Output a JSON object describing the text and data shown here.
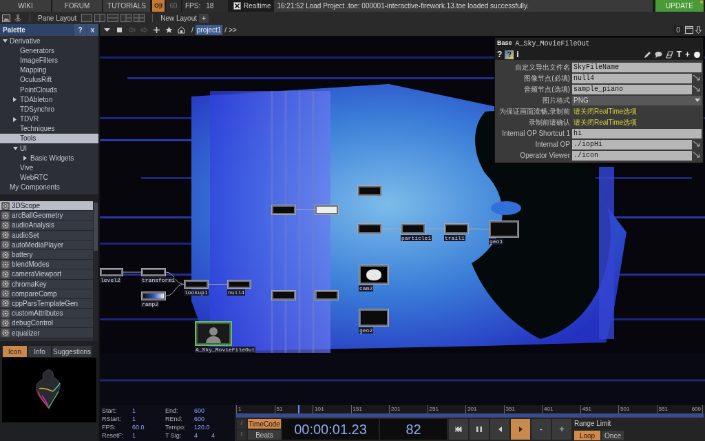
{
  "menu_bar": {
    "buttons": [
      {
        "label": "WIKI"
      },
      {
        "label": "FORUM"
      },
      {
        "label": "TUTORIALS"
      }
    ],
    "perform_toggle": {
      "label": "O|I",
      "on": true
    },
    "fps_cap": "60",
    "fps": {
      "label": "FPS:",
      "value": "18"
    },
    "realtime": {
      "label": "Realtime",
      "checked": true
    },
    "message": "16:21:52 Load Project .toe: 000001-interactive-firework.13.toe loaded successfully.",
    "update_button": {
      "label": "UPDATE",
      "notify": true
    }
  },
  "layout_bar": {
    "pane_layout": "Pane Layout",
    "layouts": [
      {
        "kind": "single"
      },
      {
        "kind": "columns"
      },
      {
        "kind": "rows"
      },
      {
        "kind": "triple"
      },
      {
        "kind": "quad"
      }
    ],
    "new_layout": "New Layout",
    "add_button": "+"
  },
  "palette": {
    "title": "Palette",
    "buttons": [
      "?",
      "x"
    ],
    "tree": [
      {
        "label": "Derivative",
        "kind": "folder",
        "expanded": true,
        "selected": false,
        "children": [
          {
            "label": "Generators",
            "kind": "leaf",
            "selected": false
          },
          {
            "label": "ImageFilters",
            "kind": "leaf",
            "selected": false
          },
          {
            "label": "Mapping",
            "kind": "leaf",
            "selected": false
          },
          {
            "label": "OculusRift",
            "kind": "leaf",
            "selected": false
          },
          {
            "label": "PointClouds",
            "kind": "leaf",
            "selected": false
          },
          {
            "label": "TDAbleton",
            "kind": "folder",
            "expanded": false,
            "selected": false
          },
          {
            "label": "TDSynchro",
            "kind": "leaf",
            "selected": false
          },
          {
            "label": "TDVR",
            "kind": "folder",
            "expanded": false,
            "selected": false
          },
          {
            "label": "Techniques",
            "kind": "leaf",
            "selected": false
          },
          {
            "label": "Tools",
            "kind": "leaf",
            "selected": true
          },
          {
            "label": "UI",
            "kind": "folder",
            "expanded": true,
            "selected": false,
            "children": [
              {
                "label": "Basic Widgets",
                "kind": "folder",
                "expanded": false,
                "selected": false
              }
            ]
          },
          {
            "label": "Vive",
            "kind": "leaf",
            "selected": false
          },
          {
            "label": "WebRTC",
            "kind": "leaf",
            "selected": false
          }
        ]
      },
      {
        "label": "My Components",
        "kind": "leaf",
        "selected": false
      }
    ],
    "components": [
      {
        "label": "3DScope",
        "selected": true
      },
      {
        "label": "arcBallGeometry",
        "selected": false
      },
      {
        "label": "audioAnalysis",
        "selected": false
      },
      {
        "label": "audioSet",
        "selected": false
      },
      {
        "label": "autoMediaPlayer",
        "selected": false
      },
      {
        "label": "battery",
        "selected": false
      },
      {
        "label": "blendModes",
        "selected": false
      },
      {
        "label": "cameraViewport",
        "selected": false
      },
      {
        "label": "chromaKey",
        "selected": false
      },
      {
        "label": "compareComp",
        "selected": false
      },
      {
        "label": "cppParsTemplateGen",
        "selected": false
      },
      {
        "label": "customAttributes",
        "selected": false
      },
      {
        "label": "debugControl",
        "selected": false
      },
      {
        "label": "equalizer",
        "selected": false
      }
    ],
    "tabs": [
      {
        "label": "Icon",
        "selected": true
      },
      {
        "label": "Info",
        "selected": false
      },
      {
        "label": "Suggestions",
        "selected": false
      }
    ]
  },
  "network_bar": {
    "tools": [
      {
        "kind": "menu",
        "disabled": false
      },
      {
        "kind": "stop",
        "disabled": false
      },
      {
        "kind": "back",
        "disabled": true
      },
      {
        "kind": "forward",
        "disabled": true
      },
      {
        "kind": "add",
        "disabled": false
      },
      {
        "kind": "star",
        "disabled": false
      },
      {
        "kind": "home",
        "disabled": false
      }
    ],
    "path": {
      "root": "/",
      "current": "project1",
      "separator": "/",
      "more": ">>"
    },
    "counter": "0"
  },
  "network": {
    "nodes": [
      {
        "kind": "dark",
        "selected": false
      },
      {
        "kind": "dark",
        "selected": false
      },
      {
        "kind": "bright",
        "selected": false
      },
      {
        "kind": "dark",
        "selected": false
      },
      {
        "label": "particle1",
        "kind": "dark",
        "selected": false
      },
      {
        "label": "trail1",
        "kind": "dark",
        "selected": false
      },
      {
        "label": "geo1",
        "kind": "dark",
        "selected": false
      },
      {
        "label": "level2",
        "kind": "dark",
        "selected": false
      },
      {
        "label": "transform1",
        "kind": "dark",
        "selected": false
      },
      {
        "label": "cam2",
        "kind": "picture",
        "selected": false
      },
      {
        "label": "lookup1",
        "kind": "dark",
        "selected": false
      },
      {
        "label": "null4",
        "kind": "dark",
        "selected": false
      },
      {
        "kind": "dark",
        "selected": false
      },
      {
        "kind": "dark",
        "selected": false
      },
      {
        "label": "ramp2",
        "kind": "gradient",
        "selected": false
      },
      {
        "label": "geo2",
        "kind": "dark",
        "selected": false
      },
      {
        "label": "A_Sky_MovieFileOut",
        "kind": "avatar",
        "selected": true
      }
    ]
  },
  "parameters": {
    "type": "Base",
    "name": "A_Sky_MovieFileOut",
    "help": [
      {
        "kind": "plain",
        "label": "?"
      },
      {
        "kind": "python",
        "label": "?"
      },
      {
        "kind": "plain",
        "label": "i"
      }
    ],
    "tools": [
      {
        "kind": "pencil"
      },
      {
        "kind": "comment"
      },
      {
        "kind": "eraser"
      },
      {
        "kind": "glyph",
        "label": "T"
      },
      {
        "kind": "glyph",
        "label": "+"
      },
      {
        "kind": "dot"
      }
    ],
    "rows": [
      {
        "label": "自定义导出文件名",
        "value": "SkyFileName",
        "kind": "field"
      },
      {
        "label": "图像节点(必填)",
        "value": "null4",
        "kind": "reference"
      },
      {
        "label": "音频节点(选填)",
        "value": "sample_piano",
        "kind": "reference"
      },
      {
        "label": "图片格式",
        "value": "PNG",
        "kind": "menu"
      },
      {
        "label": "为保证画面流畅,录制前",
        "value": "请关闭RealTime选项",
        "kind": "note"
      },
      {
        "label": "录制前请确认",
        "value": "请关闭RealTime选项",
        "kind": "note"
      },
      {
        "label": "Internal OP Shortcut 1",
        "value": "hi",
        "kind": "field"
      },
      {
        "label": "Internal OP",
        "value": "./iopHi",
        "kind": "reference"
      },
      {
        "label": "Operator Viewer",
        "value": "./icon",
        "kind": "reference"
      }
    ]
  },
  "timeline": {
    "stats": [
      {
        "label": "Start:",
        "values": [
          "1"
        ]
      },
      {
        "label": "End:",
        "values": [
          "600"
        ]
      },
      {
        "label": "RStart:",
        "values": [
          "1"
        ]
      },
      {
        "label": "REnd:",
        "values": [
          "600"
        ]
      },
      {
        "label": "FPS:",
        "values": [
          "60.0"
        ]
      },
      {
        "label": "Tempo:",
        "values": [
          "120.0"
        ]
      },
      {
        "label": "ResetF:",
        "values": [
          "1"
        ]
      },
      {
        "label": "T Sig:",
        "values": [
          "4",
          "4"
        ]
      }
    ],
    "ticks": [
      "1",
      "51",
      "101",
      "151",
      "201",
      "251",
      "301",
      "351",
      "401",
      "451",
      "501",
      "551",
      "600"
    ],
    "playhead": {
      "level": 0.135
    },
    "side_buttons": [
      "/",
      "I"
    ],
    "time_modes": [
      {
        "label": "TimeCode",
        "selected": true
      },
      {
        "label": "Beats",
        "selected": false
      }
    ],
    "timecode": "00:00:01.23",
    "frame": "82",
    "transport": [
      {
        "kind": "start",
        "selected": false
      },
      {
        "kind": "pause",
        "selected": false
      },
      {
        "kind": "back",
        "selected": false
      },
      {
        "kind": "play",
        "selected": true
      },
      {
        "kind": "glyph",
        "label": "-",
        "selected": false
      },
      {
        "kind": "glyph",
        "label": "+",
        "selected": false
      }
    ],
    "range_limit": {
      "label": "Range Limit",
      "options": [
        {
          "label": "Loop",
          "selected": true
        },
        {
          "label": "Once",
          "selected": false
        }
      ]
    }
  }
}
